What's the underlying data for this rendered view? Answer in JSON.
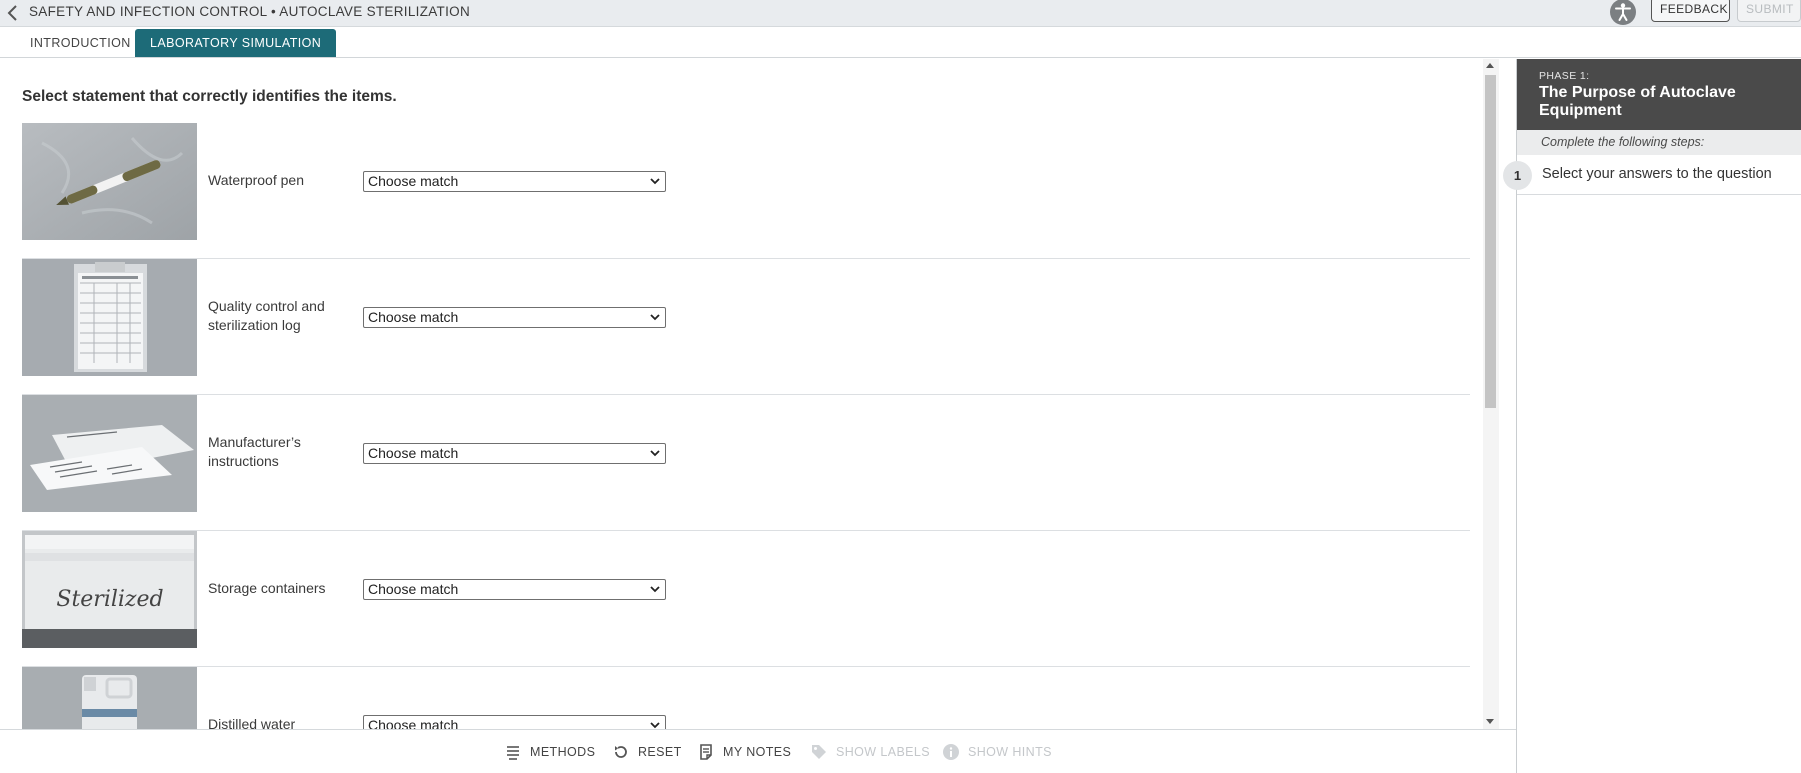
{
  "header": {
    "breadcrumb": "SAFETY AND INFECTION CONTROL • AUTOCLAVE STERILIZATION",
    "feedback_label": "FEEDBACK",
    "submit_label": "SUBMIT"
  },
  "tabs": [
    {
      "label": "INTRODUCTION",
      "active": false
    },
    {
      "label": "LABORATORY SIMULATION",
      "active": true
    }
  ],
  "main": {
    "instruction": "Select statement that correctly identifies the items.",
    "items": [
      {
        "label": "Waterproof pen",
        "image": "waterproof-pen-photo",
        "selected": "Choose match"
      },
      {
        "label": "Quality control and sterilization log",
        "image": "sterilization-log-clipboard-photo",
        "selected": "Choose match"
      },
      {
        "label": "Manufacturer’s instructions",
        "image": "manufacturer-instructions-photo",
        "selected": "Choose match"
      },
      {
        "label": "Storage containers",
        "image": "storage-container-photo",
        "image_text": "Sterilized",
        "selected": "Choose match"
      },
      {
        "label": "Distilled water",
        "image": "distilled-water-jug-photo",
        "selected": "Choose match"
      }
    ]
  },
  "toolbar": {
    "methods": "METHODS",
    "reset": "RESET",
    "my_notes": "MY NOTES",
    "show_labels": "SHOW LABELS",
    "show_hints": "SHOW HINTS"
  },
  "panel": {
    "phase_label": "PHASE 1:",
    "phase_title": "The Purpose of Autoclave Equipment",
    "steps_hint": "Complete the following steps:",
    "steps": [
      {
        "number": "1",
        "text": "Select your answers to the question"
      }
    ]
  },
  "colors": {
    "accent": "#1d6b78",
    "header_bg": "#e9ecef",
    "panel_header": "#4a4a4a"
  }
}
